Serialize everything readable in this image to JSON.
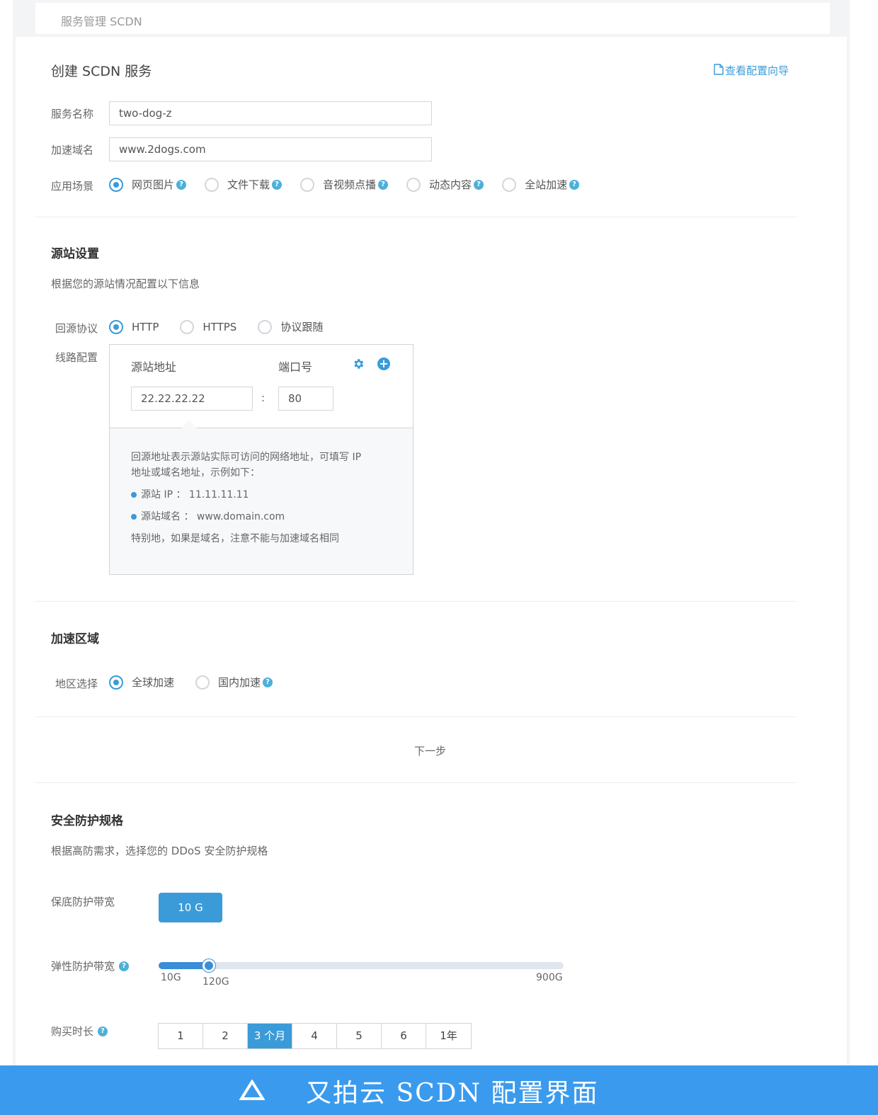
{
  "breadcrumb": "服务管理 SCDN",
  "page_title": "创建 SCDN 服务",
  "guide_link": "查看配置向导",
  "form": {
    "service_name_label": "服务名称",
    "service_name_value": "two-dog-z",
    "domain_label": "加速域名",
    "domain_value": "www.2dogs.com",
    "scenario_label": "应用场景",
    "scenarios": [
      {
        "label": "网页图片",
        "checked": true
      },
      {
        "label": "文件下载",
        "checked": false
      },
      {
        "label": "音视频点播",
        "checked": false
      },
      {
        "label": "动态内容",
        "checked": false
      },
      {
        "label": "全站加速",
        "checked": false
      }
    ]
  },
  "origin_section": {
    "title": "源站设置",
    "description": "根据您的源站情况配置以下信息",
    "protocol_label": "回源协议",
    "protocols": [
      {
        "label": "HTTP",
        "checked": true
      },
      {
        "label": "HTTPS",
        "checked": false
      },
      {
        "label": "协议跟随",
        "checked": false
      }
    ],
    "line_label": "线路配置",
    "address_header": "源站地址",
    "port_header": "端口号",
    "address_value": "22.22.22.22",
    "colon": ":",
    "port_value": "80",
    "tip_line1": "回源地址表示源站实际可访问的网络地址，可填写 IP",
    "tip_line2": "地址或域名地址，示例如下：",
    "tip_ip": "源站 IP ： 11.11.11.11",
    "tip_domain": "源站域名 ： www.domain.com",
    "tip_note": "特别地，如果是域名，注意不能与加速域名相同"
  },
  "region_section": {
    "title": "加速区域",
    "region_label": "地区选择",
    "regions": [
      {
        "label": "全球加速",
        "checked": true
      },
      {
        "label": "国内加速",
        "checked": false
      }
    ]
  },
  "next_step": "下一步",
  "security_section": {
    "title": "安全防护规格",
    "description": "根据高防需求，选择您的 DDoS 安全防护规格",
    "base_bw_label": "保底防护带宽",
    "base_bw_value": "10 G",
    "elastic_bw_label": "弹性防护带宽",
    "slider_min": "10G",
    "slider_current": "120G",
    "slider_max": "900G",
    "slider_min_value": 10,
    "slider_current_value": 120,
    "slider_max_value": 900,
    "duration_label": "购买时长",
    "durations": [
      {
        "label": "1",
        "active": false
      },
      {
        "label": "2",
        "active": false
      },
      {
        "label": "3 个月",
        "active": true
      },
      {
        "label": "4",
        "active": false
      },
      {
        "label": "5",
        "active": false
      },
      {
        "label": "6",
        "active": false
      },
      {
        "label": "1年",
        "active": false
      }
    ]
  },
  "caption": "又拍云 SCDN 配置界面",
  "colors": {
    "accent": "#3a9bd8",
    "caption_bar": "#3a9bee"
  }
}
